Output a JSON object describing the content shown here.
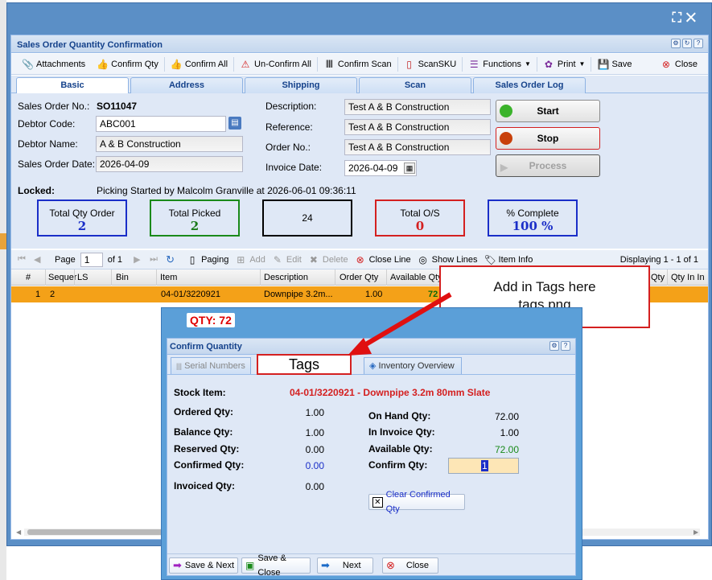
{
  "window": {
    "title": "Sales Order Quantity Confirmation",
    "maximize_glyph": "⛶",
    "close_glyph": "✕"
  },
  "toolbar": {
    "attachments": "Attachments",
    "confirm_qty": "Confirm Qty",
    "confirm_all": "Confirm All",
    "unconfirm_all": "Un-Confirm All",
    "confirm_scan": "Confirm Scan",
    "scan_sku": "ScanSKU",
    "functions": "Functions",
    "print": "Print",
    "save": "Save",
    "close": "Close"
  },
  "tabs": [
    "Basic",
    "Address",
    "Shipping",
    "Scan",
    "Sales Order Log"
  ],
  "form": {
    "so_no_label": "Sales Order No.:",
    "so_no": "SO11047",
    "debtor_code_label": "Debtor Code:",
    "debtor_code": "ABC001",
    "debtor_name_label": "Debtor Name:",
    "debtor_name": "A & B Construction",
    "so_date_label": "Sales Order Date:",
    "so_date": "2026-04-09",
    "description_label": "Description:",
    "description": "Test A & B Construction",
    "reference_label": "Reference:",
    "reference": "Test A & B Construction",
    "order_no_label": "Order No.:",
    "order_no": "Test A & B Construction",
    "invoice_date_label": "Invoice Date:",
    "invoice_date": "2026-04-09",
    "locked_label": "Locked:",
    "locked": "Picking Started by Malcolm Granville at 2026-06-01 09:36:11"
  },
  "actions": {
    "start": "Start",
    "stop": "Stop",
    "process": "Process"
  },
  "stats": {
    "total_qty_order_label": "Total Qty Order",
    "total_qty_order": "2",
    "total_picked_label": "Total Picked",
    "total_picked": "2",
    "middle_value": "24",
    "total_os_label": "Total O/S",
    "total_os": "0",
    "pct_complete_label": "% Complete",
    "pct_complete": "100 %"
  },
  "grid_toolbar": {
    "page_label": "Page",
    "page_value": "1",
    "of_label": "of 1",
    "paging": "Paging",
    "add": "Add",
    "edit": "Edit",
    "delete": "Delete",
    "close_line": "Close Line",
    "show_lines": "Show Lines",
    "item_info": "Item Info",
    "displaying": "Displaying 1 - 1 of 1"
  },
  "grid": {
    "headers": [
      "#",
      "Sequer",
      "LS",
      "Bin",
      "Item",
      "Description",
      "Order Qty",
      "Available Qty",
      "Qty",
      "Qty In In"
    ],
    "row": {
      "num": "1",
      "seq": "2",
      "item": "04-01/3220921",
      "description": "Downpipe 3.2m...",
      "order_qty": "1.00",
      "available": "72"
    }
  },
  "callout": {
    "line1": "Add in Tags here",
    "line2": "tags.png"
  },
  "dialog": {
    "qty_badge": "QTY: 72",
    "title": "Confirm Quantity",
    "tabs": {
      "serial": "Serial Numbers",
      "tags": "Tags",
      "inventory": "Inventory Overview"
    },
    "stock_item_label": "Stock Item:",
    "stock_item": "04-01/3220921 - Downpipe 3.2m 80mm Slate",
    "ordered_label": "Ordered Qty:",
    "ordered": "1.00",
    "balance_label": "Balance Qty:",
    "balance": "1.00",
    "reserved_label": "Reserved Qty:",
    "reserved": "0.00",
    "confirmed_label": "Confirmed Qty:",
    "confirmed": "0.00",
    "invoiced_label": "Invoiced Qty:",
    "invoiced": "0.00",
    "onhand_label": "On Hand Qty:",
    "onhand": "72.00",
    "ininvoice_label": "In Invoice Qty:",
    "ininvoice": "1.00",
    "available_label": "Available Qty:",
    "available": "72.00",
    "confirm_label": "Confirm Qty:",
    "confirm_value": "1",
    "clear_btn": "Clear Confirmed Qty",
    "footer": {
      "save_next": "Save & Next",
      "save_close": "Save & Close",
      "next": "Next",
      "close": "Close"
    }
  },
  "colors": {
    "accent": "#15428b",
    "selected_row": "#f4a118",
    "highlight": "#d42020"
  }
}
